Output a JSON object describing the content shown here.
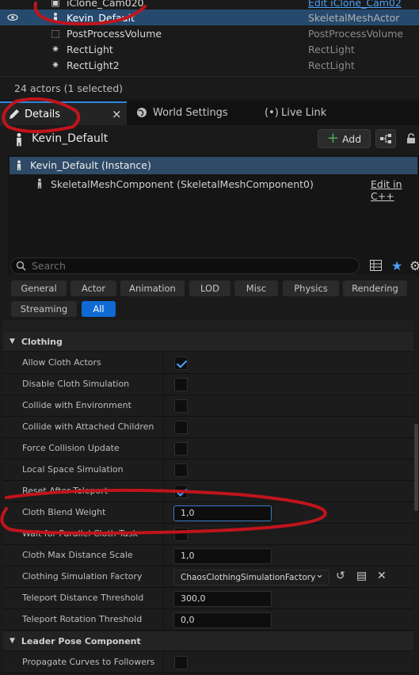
{
  "outliner": {
    "rows": [
      {
        "name": "iClone_Cam020",
        "type": "Edit iClone_Cam02",
        "icon": "camera-icon"
      },
      {
        "name": "Kevin_Default",
        "type": "SkeletalMeshActor",
        "icon": "skeletal-mesh-icon",
        "selected": true
      },
      {
        "name": "PostProcessVolume",
        "type": "PostProcessVolume",
        "icon": "post-process-icon"
      },
      {
        "name": "RectLight",
        "type": "RectLight",
        "icon": "rect-light-icon"
      },
      {
        "name": "RectLight2",
        "type": "RectLight",
        "icon": "rect-light-icon"
      }
    ],
    "status": "24 actors (1 selected)"
  },
  "tabs": {
    "details": "Details",
    "world_settings": "World Settings",
    "live_link": "Live Link",
    "close": "×"
  },
  "details": {
    "actor_name": "Kevin_Default",
    "add_label": "Add",
    "instance_label": "Kevin_Default (Instance)",
    "component_label": "SkeletalMeshComponent (SkeletalMeshComponent0)",
    "edit_cpp": "Edit in C++",
    "search_placeholder": "Search"
  },
  "filters": [
    "General",
    "Actor",
    "Animation",
    "LOD",
    "Misc",
    "Physics",
    "Rendering",
    "Streaming",
    "All"
  ],
  "active_filter": "All",
  "sections": {
    "clothing": "Clothing",
    "leader_pose": "Leader Pose Component"
  },
  "clothing_props": [
    {
      "label": "Allow Cloth Actors",
      "kind": "check",
      "checked": true
    },
    {
      "label": "Disable Cloth Simulation",
      "kind": "check",
      "checked": false
    },
    {
      "label": "Collide with Environment",
      "kind": "check",
      "checked": false
    },
    {
      "label": "Collide with Attached Children",
      "kind": "check",
      "checked": false
    },
    {
      "label": "Force Collision Update",
      "kind": "check",
      "checked": false
    },
    {
      "label": "Local Space Simulation",
      "kind": "check",
      "checked": false
    },
    {
      "label": "Reset After Teleport",
      "kind": "check",
      "checked": true
    },
    {
      "label": "Cloth Blend Weight",
      "kind": "num",
      "value": "1,0"
    },
    {
      "label": "Wait for Parallel Cloth Task",
      "kind": "check",
      "checked": false
    },
    {
      "label": "Cloth Max Distance Scale",
      "kind": "num",
      "value": "1,0"
    },
    {
      "label": "Clothing Simulation Factory",
      "kind": "combo",
      "value": "ChaosClothingSimulationFactory"
    },
    {
      "label": "Teleport Distance Threshold",
      "kind": "num",
      "value": "300,0"
    },
    {
      "label": "Teleport Rotation Threshold",
      "kind": "num",
      "value": "0,0"
    }
  ],
  "leader_props": [
    {
      "label": "Propagate Curves to Followers",
      "kind": "check",
      "checked": false
    }
  ],
  "colors": {
    "accent": "#0f6ad4",
    "selection": "#264a6e",
    "annotation": "#c0141c",
    "add_plus": "#4caf50"
  }
}
